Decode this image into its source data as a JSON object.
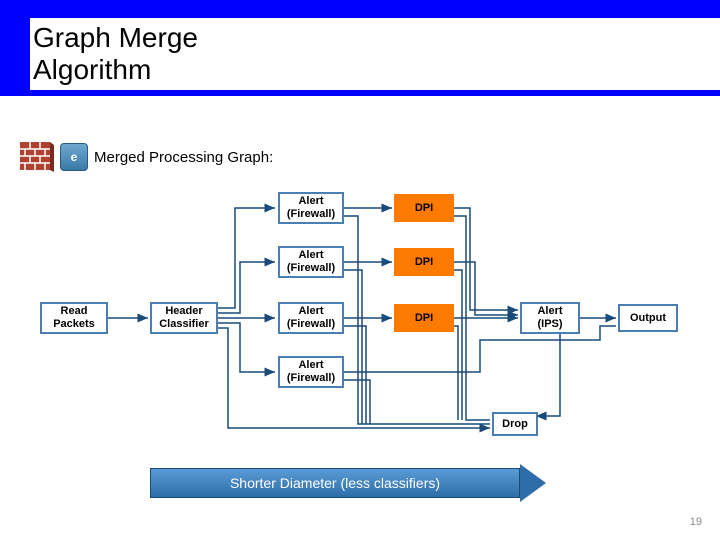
{
  "header": {
    "title": "Graph Merge Algorithm"
  },
  "subtitle": "Merged Processing Graph:",
  "icons": {
    "firewall": "firewall-icon",
    "app_letter": "e"
  },
  "nodes": {
    "read": "Read\nPackets",
    "hc": "Header\nClassifier",
    "af1": "Alert\n(Firewall)",
    "af2": "Alert\n(Firewall)",
    "af3": "Alert\n(Firewall)",
    "af4": "Alert\n(Firewall)",
    "dpi1": "DPI",
    "dpi2": "DPI",
    "dpi3": "DPI",
    "aips": "Alert\n(IPS)",
    "out": "Output",
    "drop": "Drop"
  },
  "banner": "Shorter Diameter (less classifiers)",
  "page": "19"
}
